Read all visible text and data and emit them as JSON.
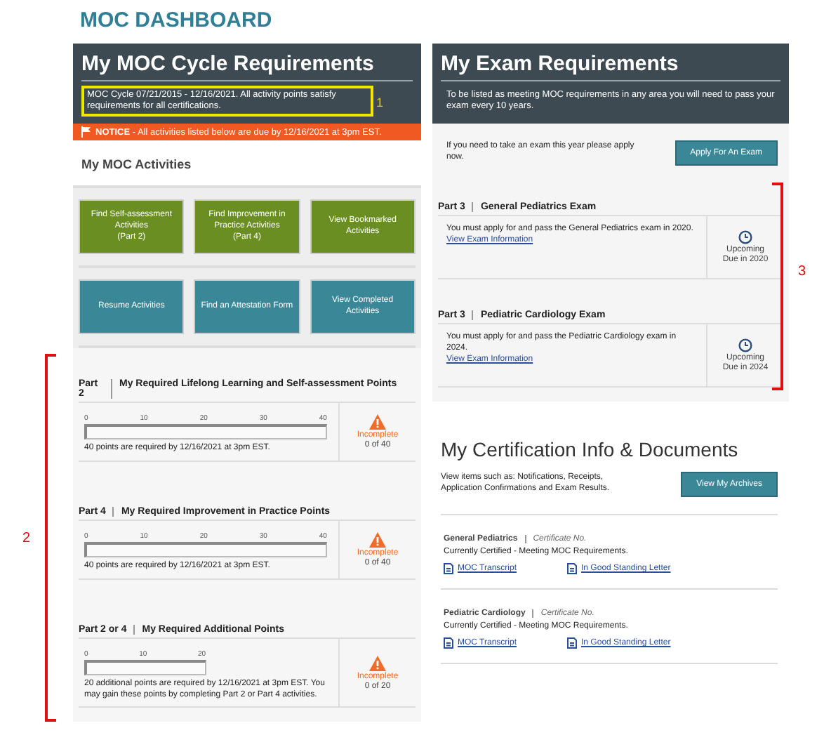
{
  "page_title": "MOC DASHBOARD",
  "cycle": {
    "title": "My MOC Cycle Requirements",
    "summary": "MOC Cycle 07/21/2015 - 12/16/2021. All activity points satisfy requirements for all certifications.",
    "callout": "1",
    "notice_label": "NOTICE",
    "notice_text": "- All activities listed below are due by 12/16/2021 at 3pm EST."
  },
  "activities": {
    "title": "My MOC Activities",
    "buttons": [
      {
        "label": "Find Self-assessment Activities\n(Part 2)",
        "kind": "primary"
      },
      {
        "label": "Find Improvement in Practice Activities\n(Part 4)",
        "kind": "primary"
      },
      {
        "label": "View Bookmarked Activities",
        "kind": "primary"
      },
      {
        "label": "Resume Activities",
        "kind": "secondary"
      },
      {
        "label": "Find an Attestation Form",
        "kind": "secondary"
      },
      {
        "label": "View Completed Activities",
        "kind": "secondary"
      }
    ]
  },
  "requirements_callout": "2",
  "requirements": [
    {
      "part": "Part 2",
      "title": "My Required Lifelong Learning and Self-assessment Points",
      "ticks": [
        "0",
        "10",
        "20",
        "30",
        "40"
      ],
      "note": "40 points are required by 12/16/2021 at 3pm EST.",
      "status": "Incomplete",
      "count": "0 of 40"
    },
    {
      "part": "Part 4",
      "title": "My Required Improvement in Practice Points",
      "ticks": [
        "0",
        "10",
        "20",
        "30",
        "40"
      ],
      "note": "40 points are required by 12/16/2021 at 3pm EST.",
      "status": "Incomplete",
      "count": "0 of 40"
    },
    {
      "part": "Part 2 or 4",
      "title": "My Required Additional Points",
      "ticks": [
        "0",
        "10",
        "20"
      ],
      "note": "20 additional points are required by 12/16/2021 at 3pm EST.  You may gain these points by completing Part 2 or Part 4 activities.",
      "status": "Incomplete",
      "count": "0 of 20"
    }
  ],
  "exam": {
    "title": "My Exam Requirements",
    "description": "To be listed as meeting MOC requirements in any area you will need to pass your exam every 10 years.",
    "apply_text": "If you need to take an exam this year please apply now.",
    "apply_button": "Apply For An Exam",
    "callout": "3",
    "exams": [
      {
        "part": "Part 3",
        "title": "General Pediatrics Exam",
        "text": "You must apply for and pass the General Pediatrics exam in 2020.",
        "link": "View Exam Information",
        "status": "Upcoming",
        "due": "Due in 2020"
      },
      {
        "part": "Part 3",
        "title": "Pediatric Cardiology Exam",
        "text": "You must apply for and pass the Pediatric Cardiology exam in 2024.",
        "link": "View Exam Information",
        "status": "Upcoming",
        "due": "Due in 2024"
      }
    ]
  },
  "certification": {
    "title": "My Certification Info & Documents",
    "description": "View items such as: Notifications, Receipts, Application Confirmations and Exam Results.",
    "button": "View My Archives",
    "certs": [
      {
        "name": "General Pediatrics",
        "cert_label": "Certificate No.",
        "status": "Currently Certified - Meeting MOC Requirements.",
        "links": [
          "MOC Transcript",
          "In Good Standing Letter"
        ]
      },
      {
        "name": "Pediatric Cardiology",
        "cert_label": "Certificate No.",
        "status": "Currently Certified - Meeting MOC Requirements.",
        "links": [
          "MOC Transcript",
          "In Good Standing Letter"
        ]
      }
    ]
  }
}
